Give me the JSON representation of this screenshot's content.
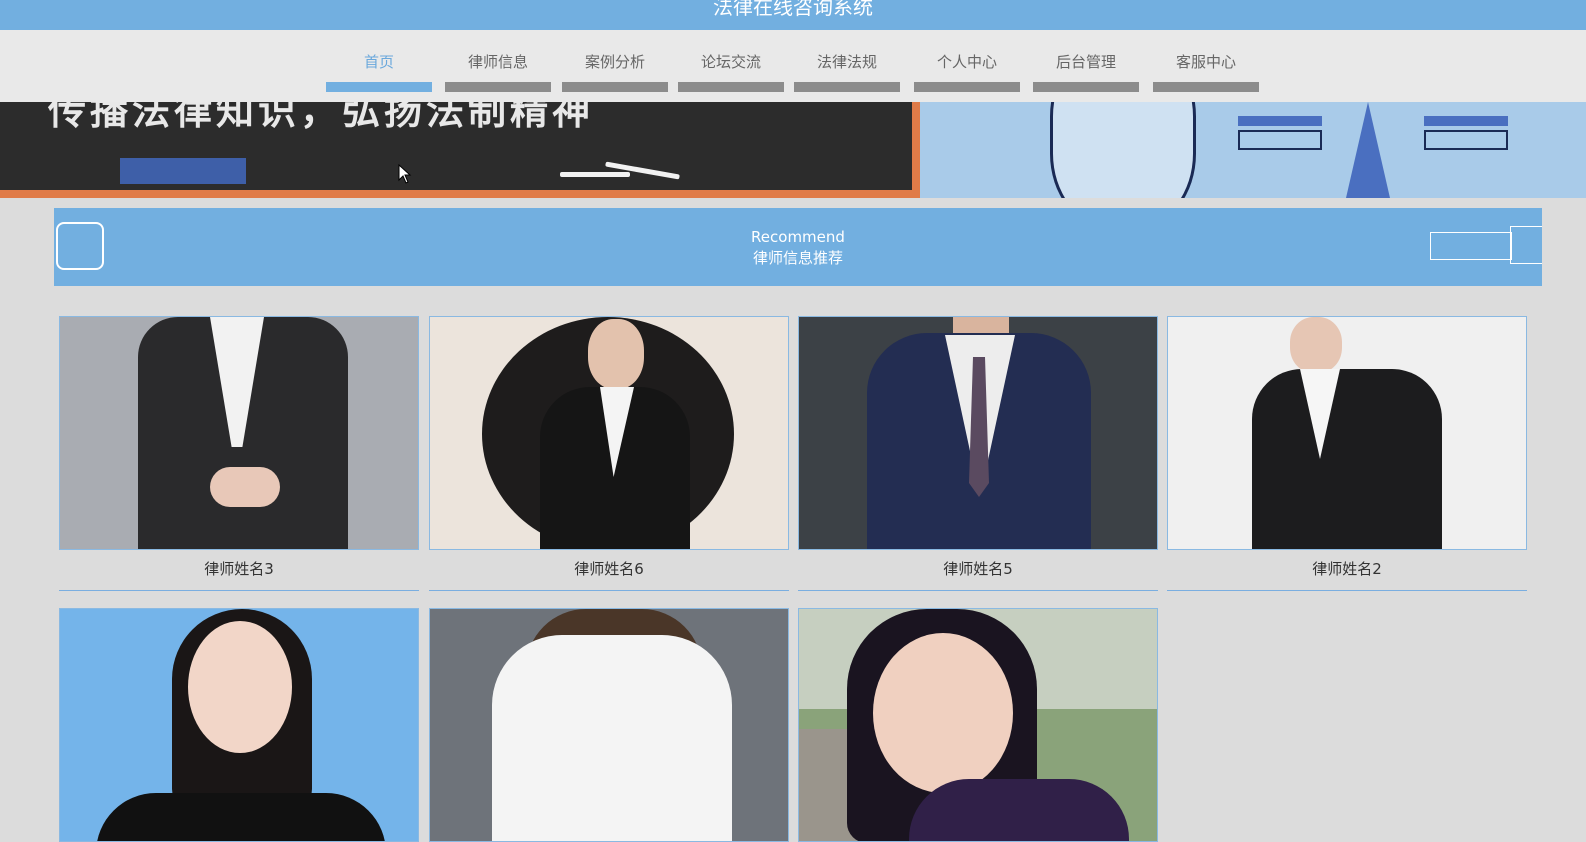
{
  "header": {
    "title": "法律在线咨询系统"
  },
  "nav": {
    "items": [
      {
        "label": "首页",
        "active": true
      },
      {
        "label": "律师信息",
        "active": false
      },
      {
        "label": "案例分析",
        "active": false
      },
      {
        "label": "论坛交流",
        "active": false
      },
      {
        "label": "法律法规",
        "active": false
      },
      {
        "label": "个人中心",
        "active": false
      },
      {
        "label": "后台管理",
        "active": false
      },
      {
        "label": "客服中心",
        "active": false
      }
    ]
  },
  "banner": {
    "slogan": "传播法律知识，弘扬法制精神"
  },
  "recommend": {
    "en": "Recommend",
    "cn": "律师信息推荐"
  },
  "lawyers": [
    {
      "name": "律师姓名3"
    },
    {
      "name": "律师姓名6"
    },
    {
      "name": "律师姓名5"
    },
    {
      "name": "律师姓名2"
    },
    {
      "name": ""
    },
    {
      "name": ""
    },
    {
      "name": ""
    }
  ],
  "colors": {
    "accent": "#72afe0",
    "page_bg": "#dcdcdc",
    "nav_bg": "#e9e9e9"
  }
}
